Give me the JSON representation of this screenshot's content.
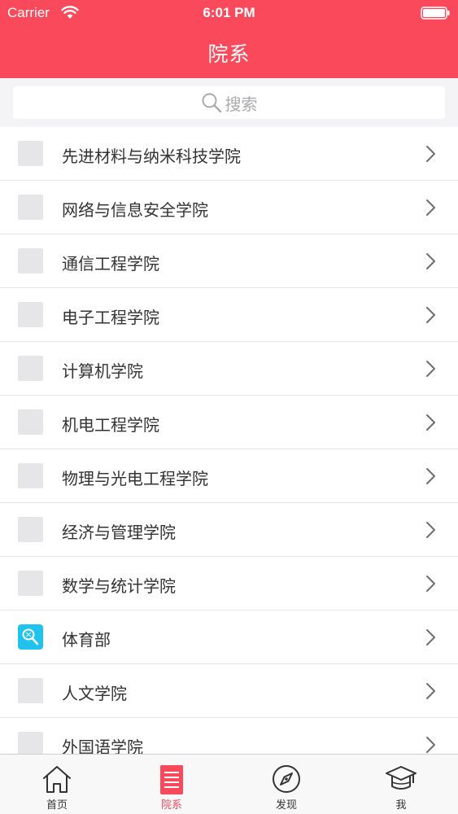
{
  "status_bar": {
    "carrier": "Carrier",
    "time": "6:01 PM"
  },
  "nav": {
    "title": "院系"
  },
  "search": {
    "placeholder": "搜索"
  },
  "departments": [
    {
      "label": "先进材料与纳米科技学院",
      "icon": "placeholder-icon"
    },
    {
      "label": "网络与信息安全学院",
      "icon": "placeholder-icon"
    },
    {
      "label": "通信工程学院",
      "icon": "placeholder-icon"
    },
    {
      "label": "电子工程学院",
      "icon": "placeholder-icon"
    },
    {
      "label": "计算机学院",
      "icon": "placeholder-icon"
    },
    {
      "label": "机电工程学院",
      "icon": "placeholder-icon"
    },
    {
      "label": "物理与光电工程学院",
      "icon": "placeholder-icon"
    },
    {
      "label": "经济与管理学院",
      "icon": "placeholder-icon"
    },
    {
      "label": "数学与统计学院",
      "icon": "placeholder-icon"
    },
    {
      "label": "体育部",
      "icon": "racket-icon"
    },
    {
      "label": "人文学院",
      "icon": "placeholder-icon"
    },
    {
      "label": "外国语学院",
      "icon": "placeholder-icon"
    }
  ],
  "tabbar": {
    "home": "首页",
    "departments": "院系",
    "discover": "发现",
    "me": "我",
    "active": "departments"
  },
  "colors": {
    "brand": "#f9495a",
    "sport_icon": "#1fc3ee"
  }
}
